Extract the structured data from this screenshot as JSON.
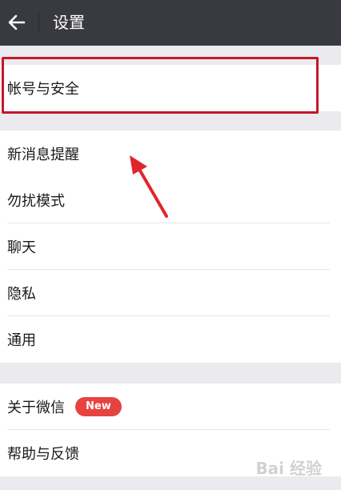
{
  "header": {
    "title": "设置",
    "back_icon": "back-arrow-icon"
  },
  "groups": [
    {
      "items": [
        {
          "label": "帐号与安全"
        }
      ]
    },
    {
      "items": [
        {
          "label": "新消息提醒"
        },
        {
          "label": "勿扰模式"
        },
        {
          "label": "聊天"
        },
        {
          "label": "隐私"
        },
        {
          "label": "通用"
        }
      ]
    },
    {
      "items": [
        {
          "label": "关于微信",
          "badge": "New"
        },
        {
          "label": "帮助与反馈"
        }
      ]
    }
  ],
  "watermark": "Bai 经验",
  "colors": {
    "header_bg": "#393a3f",
    "page_bg": "#ebeaef",
    "badge": "#e64340",
    "annotation": "#e0262b"
  }
}
